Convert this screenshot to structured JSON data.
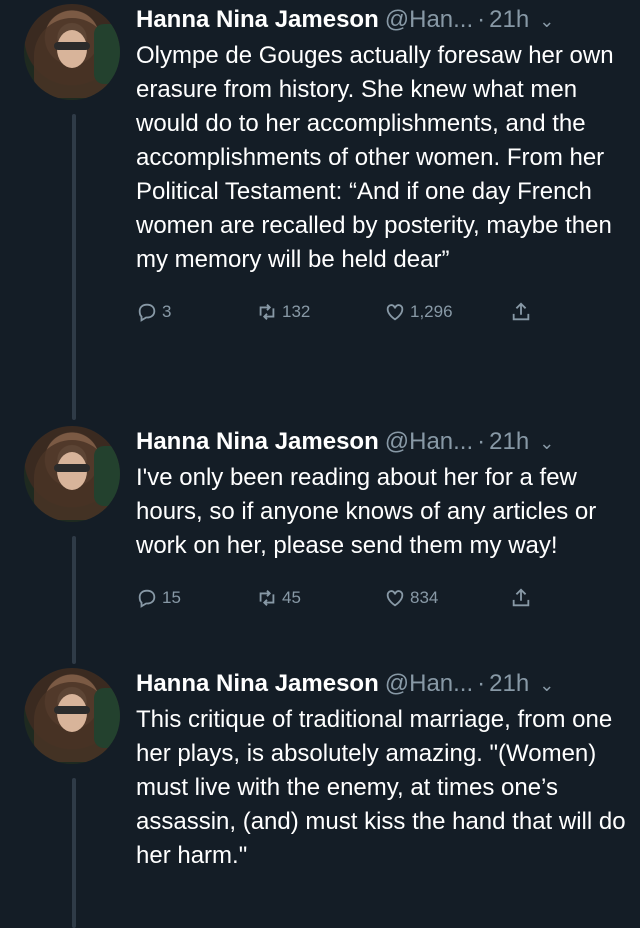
{
  "tweets": [
    {
      "name": "Hanna Nina Jameson",
      "handle": "@Han...",
      "time": "21h",
      "text": "Olympe de Gouges actually foresaw her own erasure from history. She knew what men would do to her accomplishments, and the accomplishments of other women. From her Political Testament: “And if one day French women are recalled by posterity, maybe then my memory will be held dear”",
      "replies": "3",
      "retweets": "132",
      "likes": "1,296"
    },
    {
      "name": "Hanna Nina Jameson",
      "handle": "@Han...",
      "time": "21h",
      "text": "I've only been reading about her for a few hours, so if anyone knows of any articles or work on her, please send them my way!",
      "replies": "15",
      "retweets": "45",
      "likes": "834"
    },
    {
      "name": "Hanna Nina Jameson",
      "handle": "@Han...",
      "time": "21h",
      "text": "This critique of traditional marriage, from one her plays, is absolutely amazing. \"(Women) must live with the enemy, at times one’s assassin, (and) must kiss the hand that will do her harm.\""
    }
  ],
  "icons": {
    "reply": "reply-icon",
    "retweet": "retweet-icon",
    "like": "heart-icon",
    "share": "share-icon",
    "menu": "chevron-down-icon"
  },
  "colors": {
    "background": "#141d26",
    "secondary_text": "#8899a6",
    "thread_line": "#2f3b47"
  }
}
